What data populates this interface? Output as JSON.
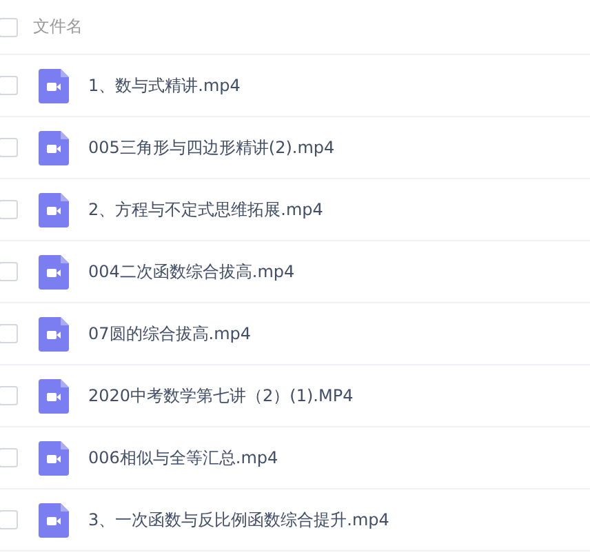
{
  "header": {
    "label": "文件名",
    "checked": false
  },
  "files": [
    {
      "name": "1、数与式精讲.mp4",
      "checked": false
    },
    {
      "name": "005三角形与四边形精讲(2).mp4",
      "checked": false
    },
    {
      "name": "2、方程与不定式思维拓展.mp4",
      "checked": false
    },
    {
      "name": "004二次函数综合拔高.mp4",
      "checked": false
    },
    {
      "name": "07圆的综合拔高.mp4",
      "checked": false
    },
    {
      "name": "2020中考数学第七讲（2）(1).MP4",
      "checked": false
    },
    {
      "name": "006相似与全等汇总.mp4",
      "checked": false
    },
    {
      "name": "3、一次函数与反比例函数综合提升.mp4",
      "checked": false
    }
  ]
}
